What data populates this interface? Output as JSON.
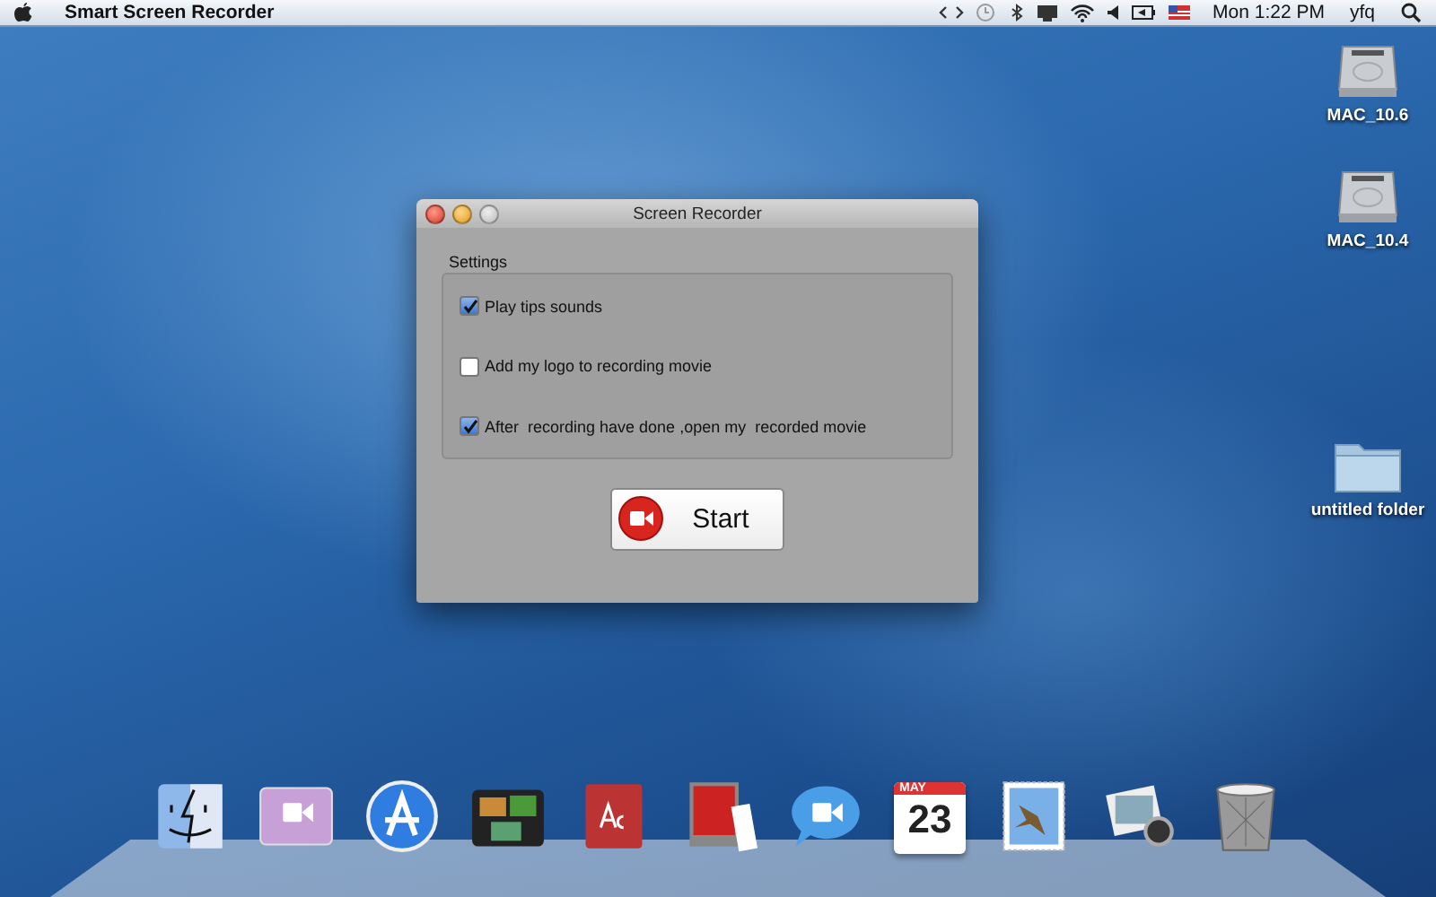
{
  "menubar": {
    "app_name": "Smart Screen Recorder",
    "clock": "Mon 1:22 PM",
    "user": "yfq"
  },
  "desktop_icons": [
    {
      "kind": "disk",
      "label": "MAC_10.6"
    },
    {
      "kind": "disk",
      "label": "MAC_10.4"
    },
    {
      "kind": "folder",
      "label": "untitled folder"
    }
  ],
  "window": {
    "title": "Screen Recorder",
    "settings_title": "Settings",
    "options": [
      {
        "label": "Play tips sounds",
        "checked": true
      },
      {
        "label": "Add my logo to recording movie",
        "checked": false
      },
      {
        "label": "After  recording have done ,open my  recorded movie",
        "checked": true
      }
    ],
    "start_button": "Start"
  },
  "dock": [
    {
      "kind": "finder"
    },
    {
      "kind": "video"
    },
    {
      "kind": "appstore"
    },
    {
      "kind": "photos"
    },
    {
      "kind": "dictionary"
    },
    {
      "kind": "booth"
    },
    {
      "kind": "chat"
    },
    {
      "kind": "calendar",
      "month": "MAY",
      "day": "23"
    },
    {
      "kind": "mail"
    },
    {
      "kind": "preview"
    },
    {
      "kind": "trash"
    }
  ]
}
